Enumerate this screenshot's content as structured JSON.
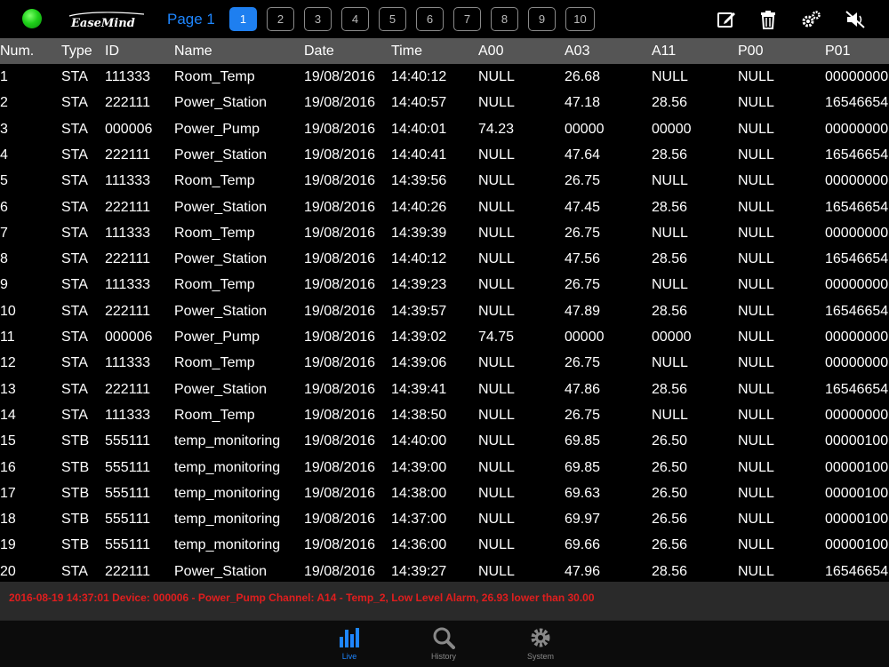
{
  "topbar": {
    "logo_text": "EaseMind",
    "page_label": "Page 1",
    "pages": [
      "1",
      "2",
      "3",
      "4",
      "5",
      "6",
      "7",
      "8",
      "9",
      "10"
    ],
    "active_page": "1",
    "accent_color": "#1e86ff",
    "status_color": "#1fd11a",
    "tools": [
      "edit-icon",
      "trash-icon",
      "settings-icon",
      "mute-icon"
    ]
  },
  "table": {
    "columns": [
      "Num.",
      "Type",
      "ID",
      "Name",
      "Date",
      "Time",
      "A00",
      "A03",
      "A11",
      "P00",
      "P01"
    ],
    "rows": [
      [
        "1",
        "STA",
        "111333",
        "Room_Temp",
        "19/08/2016",
        "14:40:12",
        "NULL",
        "26.68",
        "NULL",
        "NULL",
        "00000000"
      ],
      [
        "2",
        "STA",
        "222111",
        "Power_Station",
        "19/08/2016",
        "14:40:57",
        "NULL",
        "47.18",
        "28.56",
        "NULL",
        "16546654"
      ],
      [
        "3",
        "STA",
        "000006",
        "Power_Pump",
        "19/08/2016",
        "14:40:01",
        "74.23",
        "00000",
        "00000",
        "NULL",
        "00000000"
      ],
      [
        "4",
        "STA",
        "222111",
        "Power_Station",
        "19/08/2016",
        "14:40:41",
        "NULL",
        "47.64",
        "28.56",
        "NULL",
        "16546654"
      ],
      [
        "5",
        "STA",
        "111333",
        "Room_Temp",
        "19/08/2016",
        "14:39:56",
        "NULL",
        "26.75",
        "NULL",
        "NULL",
        "00000000"
      ],
      [
        "6",
        "STA",
        "222111",
        "Power_Station",
        "19/08/2016",
        "14:40:26",
        "NULL",
        "47.45",
        "28.56",
        "NULL",
        "16546654"
      ],
      [
        "7",
        "STA",
        "111333",
        "Room_Temp",
        "19/08/2016",
        "14:39:39",
        "NULL",
        "26.75",
        "NULL",
        "NULL",
        "00000000"
      ],
      [
        "8",
        "STA",
        "222111",
        "Power_Station",
        "19/08/2016",
        "14:40:12",
        "NULL",
        "47.56",
        "28.56",
        "NULL",
        "16546654"
      ],
      [
        "9",
        "STA",
        "111333",
        "Room_Temp",
        "19/08/2016",
        "14:39:23",
        "NULL",
        "26.75",
        "NULL",
        "NULL",
        "00000000"
      ],
      [
        "10",
        "STA",
        "222111",
        "Power_Station",
        "19/08/2016",
        "14:39:57",
        "NULL",
        "47.89",
        "28.56",
        "NULL",
        "16546654"
      ],
      [
        "11",
        "STA",
        "000006",
        "Power_Pump",
        "19/08/2016",
        "14:39:02",
        "74.75",
        "00000",
        "00000",
        "NULL",
        "00000000"
      ],
      [
        "12",
        "STA",
        "111333",
        "Room_Temp",
        "19/08/2016",
        "14:39:06",
        "NULL",
        "26.75",
        "NULL",
        "NULL",
        "00000000"
      ],
      [
        "13",
        "STA",
        "222111",
        "Power_Station",
        "19/08/2016",
        "14:39:41",
        "NULL",
        "47.86",
        "28.56",
        "NULL",
        "16546654"
      ],
      [
        "14",
        "STA",
        "111333",
        "Room_Temp",
        "19/08/2016",
        "14:38:50",
        "NULL",
        "26.75",
        "NULL",
        "NULL",
        "00000000"
      ],
      [
        "15",
        "STB",
        "555111",
        "temp_monitoring",
        "19/08/2016",
        "14:40:00",
        "NULL",
        "69.85",
        "26.50",
        "NULL",
        "00000100"
      ],
      [
        "16",
        "STB",
        "555111",
        "temp_monitoring",
        "19/08/2016",
        "14:39:00",
        "NULL",
        "69.85",
        "26.50",
        "NULL",
        "00000100"
      ],
      [
        "17",
        "STB",
        "555111",
        "temp_monitoring",
        "19/08/2016",
        "14:38:00",
        "NULL",
        "69.63",
        "26.50",
        "NULL",
        "00000100"
      ],
      [
        "18",
        "STB",
        "555111",
        "temp_monitoring",
        "19/08/2016",
        "14:37:00",
        "NULL",
        "69.97",
        "26.56",
        "NULL",
        "00000100"
      ],
      [
        "19",
        "STB",
        "555111",
        "temp_monitoring",
        "19/08/2016",
        "14:36:00",
        "NULL",
        "69.66",
        "26.56",
        "NULL",
        "00000100"
      ],
      [
        "20",
        "STA",
        "222111",
        "Power_Station",
        "19/08/2016",
        "14:39:27",
        "NULL",
        "47.96",
        "28.56",
        "NULL",
        "16546654"
      ]
    ]
  },
  "alarm": {
    "text": "2016-08-19 14:37:01 Device: 000006 - Power_Pump   Channel: A14 - Temp_2, Low Level Alarm, 26.93 lower than 30.00",
    "color": "#e01e1e"
  },
  "tabbar": {
    "tabs": [
      {
        "label": "Live",
        "icon": "bar-chart-icon",
        "active": true
      },
      {
        "label": "History",
        "icon": "search-icon",
        "active": false
      },
      {
        "label": "System",
        "icon": "gear-icon",
        "active": false
      }
    ]
  }
}
